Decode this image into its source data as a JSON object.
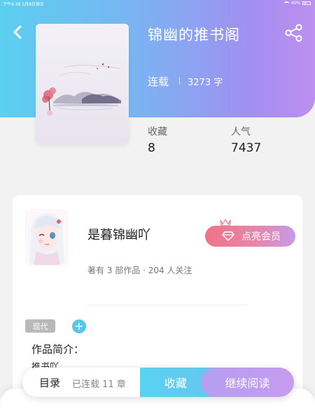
{
  "status_bar": {
    "time": "下午4:38",
    "date": "5月8日周日",
    "battery": "40%"
  },
  "book": {
    "title": "锦幽的推书阁",
    "status": "连载",
    "word_count": "3273 字",
    "stats": [
      {
        "label": "收藏",
        "value": "8"
      },
      {
        "label": "人气",
        "value": "7437"
      }
    ]
  },
  "author": {
    "name": "是暮锦幽吖",
    "meta": "著有 3 部作品 · 204 人关注",
    "member_button": "点亮会员"
  },
  "tag": "现代",
  "intro": {
    "label": "作品简介：",
    "text": "推书吖"
  },
  "action_bar": {
    "toc": "目录",
    "chapters": "已连载 11 章",
    "collect": "收藏",
    "read": "继续阅读"
  },
  "colors": {
    "header_start": "#5bd0f0",
    "header_end": "#bd8ff0",
    "member_start": "#f0728a",
    "collect": "#58d3f0",
    "read": "#c69cf0"
  },
  "icons": {
    "back": "chevron-left-icon",
    "share": "share-icon",
    "add": "plus-icon",
    "member": "diamond-icon",
    "crown": "crown-icon"
  }
}
